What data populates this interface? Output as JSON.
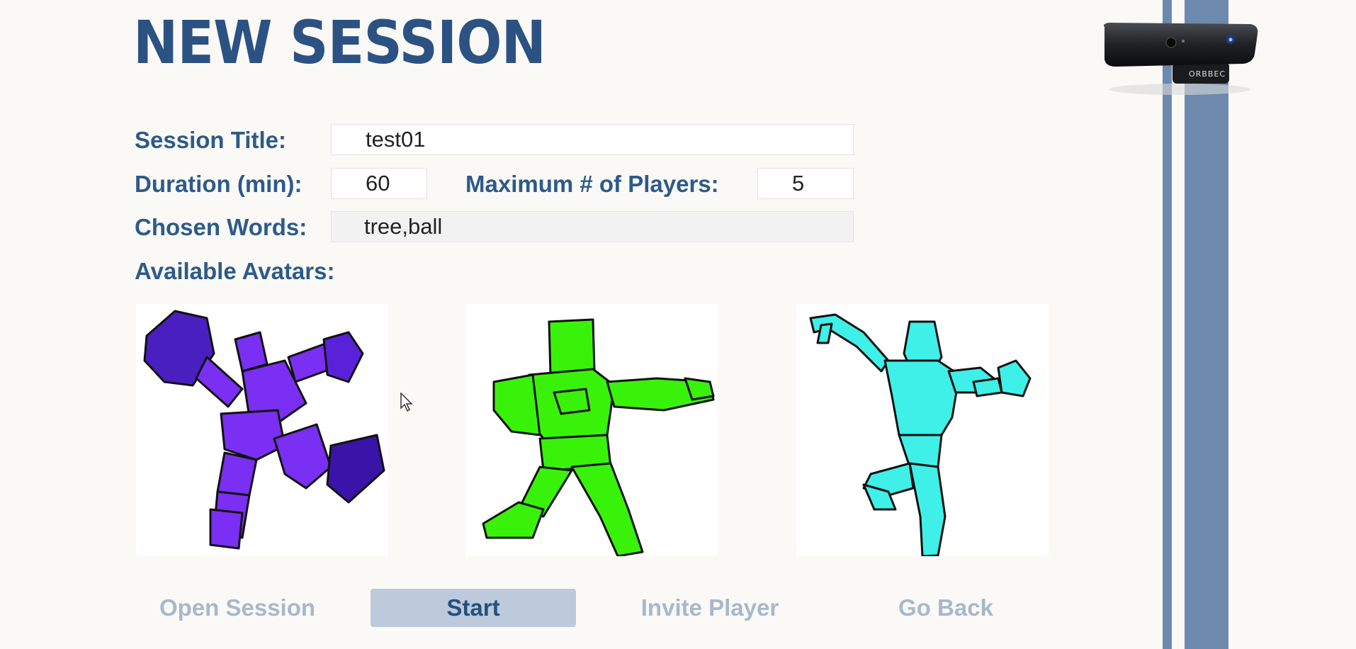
{
  "header": {
    "title": "NEW SESSION"
  },
  "form": {
    "session_title": {
      "label": "Session Title:",
      "value": "test01"
    },
    "duration": {
      "label": "Duration (min):",
      "value": "60"
    },
    "max_players": {
      "label": "Maximum # of Players:",
      "value": "5"
    },
    "chosen_words": {
      "label": "Chosen Words:",
      "value": "tree,ball"
    }
  },
  "avatars": {
    "label": "Available Avatars:",
    "items": [
      {
        "name": "purple-robot-avatar",
        "color": "#7a2ff2"
      },
      {
        "name": "green-box-avatar",
        "color": "#39f20a"
      },
      {
        "name": "cyan-slim-avatar",
        "color": "#3ef0e8"
      }
    ]
  },
  "buttons": {
    "open_session": "Open Session",
    "start": "Start",
    "invite_player": "Invite Player",
    "go_back": "Go Back"
  },
  "device": {
    "name": "depth-camera-icon",
    "brand": "ORBBEC"
  },
  "colors": {
    "title": "#2c5283",
    "label": "#2d5a8a",
    "stripe": "#6d89ad",
    "primary_button_bg": "#bccadb",
    "disabled_button_text": "#a7b8cc"
  }
}
